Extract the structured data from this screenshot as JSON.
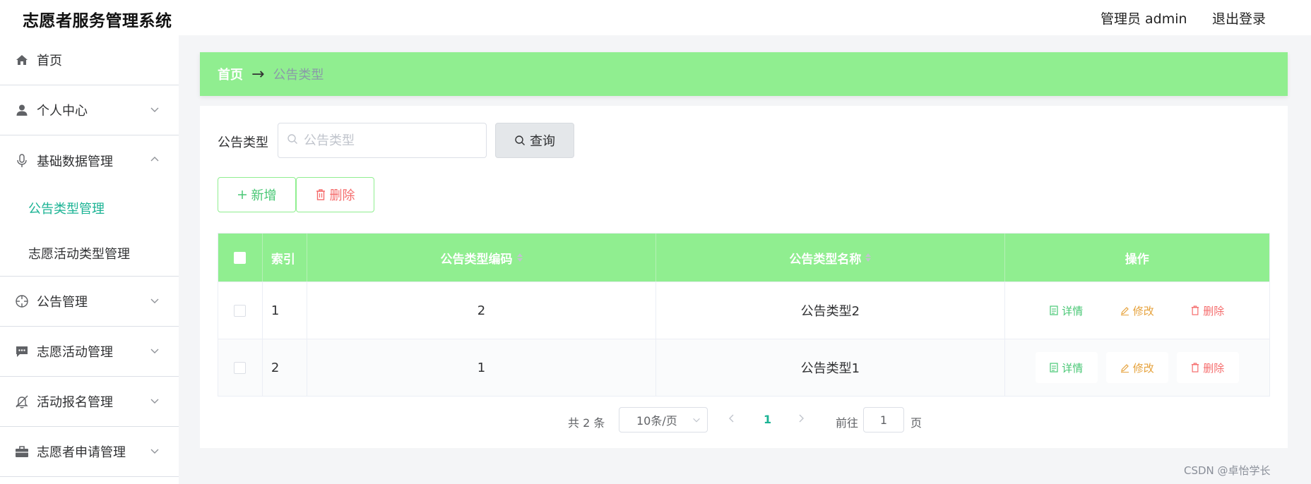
{
  "header": {
    "title": "志愿者服务管理系统",
    "user": "管理员 admin",
    "logout": "退出登录"
  },
  "sidebar": {
    "items": [
      {
        "label": "首页",
        "icon": "home-icon"
      },
      {
        "label": "个人中心",
        "icon": "user-icon"
      },
      {
        "label": "基础数据管理",
        "icon": "microphone-icon"
      },
      {
        "label": "公告管理",
        "icon": "crosshair-icon"
      },
      {
        "label": "志愿活动管理",
        "icon": "chat-icon"
      },
      {
        "label": "活动报名管理",
        "icon": "bell-off-icon"
      },
      {
        "label": "志愿者申请管理",
        "icon": "briefcase-icon"
      }
    ],
    "submenu": [
      {
        "label": "公告类型管理",
        "active": true
      },
      {
        "label": "志愿活动类型管理",
        "active": false
      }
    ]
  },
  "breadcrumb": {
    "home": "首页",
    "separator": "→",
    "current": "公告类型"
  },
  "search": {
    "label": "公告类型",
    "placeholder": "公告类型",
    "button": "查询"
  },
  "actions": {
    "add": "新增",
    "delete": "删除"
  },
  "table": {
    "columns": [
      "索引",
      "公告类型编码",
      "公告类型名称",
      "操作"
    ],
    "rows": [
      {
        "index": "1",
        "code": "2",
        "name": "公告类型2"
      },
      {
        "index": "2",
        "code": "1",
        "name": "公告类型1"
      }
    ],
    "ops": {
      "detail": "详情",
      "edit": "修改",
      "delete": "删除"
    }
  },
  "pagination": {
    "total": "共 2 条",
    "page_size": "10条/页",
    "current": "1",
    "goto_label": "前往",
    "goto_value": "1",
    "goto_unit": "页"
  },
  "watermark": "CSDN @卓怡学长",
  "colors": {
    "header_green": "#90ee90",
    "accent": "#1bb394",
    "danger": "#f56c6c",
    "warning": "#e6a23c",
    "success": "#48c774"
  }
}
